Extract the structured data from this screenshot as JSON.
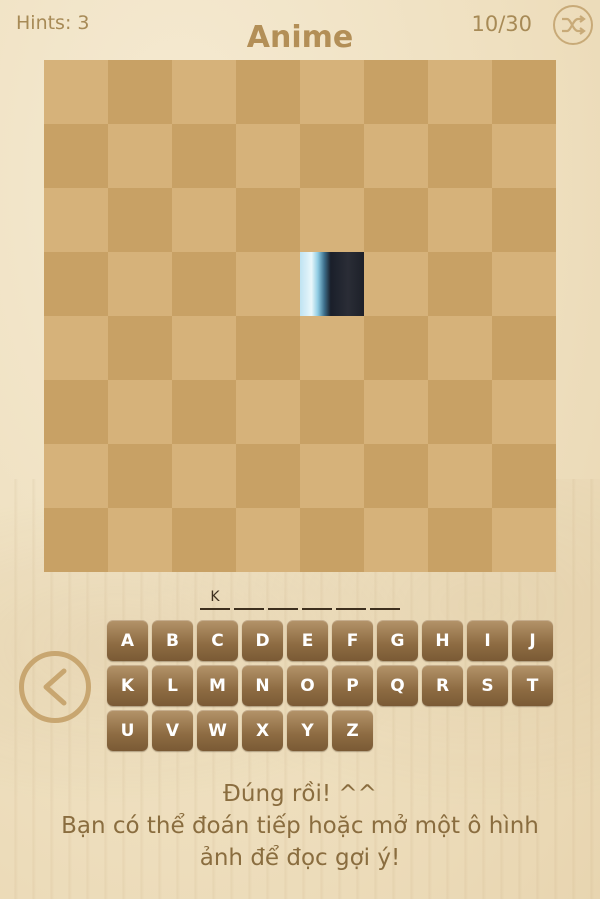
{
  "header": {
    "hints_label": "Hints: 3",
    "title": "Anime",
    "progress": "10/30",
    "shuffle_icon": "shuffle-icon"
  },
  "board": {
    "rows": 8,
    "cols": 8,
    "revealed_tiles": [
      [
        3,
        4
      ]
    ]
  },
  "answer": {
    "letters": [
      "K",
      "",
      "",
      "",
      "",
      ""
    ]
  },
  "keyboard": {
    "rows": [
      [
        "A",
        "B",
        "C",
        "D",
        "E",
        "F",
        "G",
        "H",
        "I",
        "J"
      ],
      [
        "K",
        "L",
        "M",
        "N",
        "O",
        "P",
        "Q",
        "R",
        "S",
        "T"
      ],
      [
        "U",
        "V",
        "W",
        "X",
        "Y",
        "Z"
      ]
    ]
  },
  "back_icon": "back-arrow-icon",
  "message": {
    "line1": "Đúng rồi! ^^",
    "line2": "Bạn có thể đoán tiếp hoặc mở một ô hình",
    "line3": "ảnh để đọc gợi ý!"
  }
}
